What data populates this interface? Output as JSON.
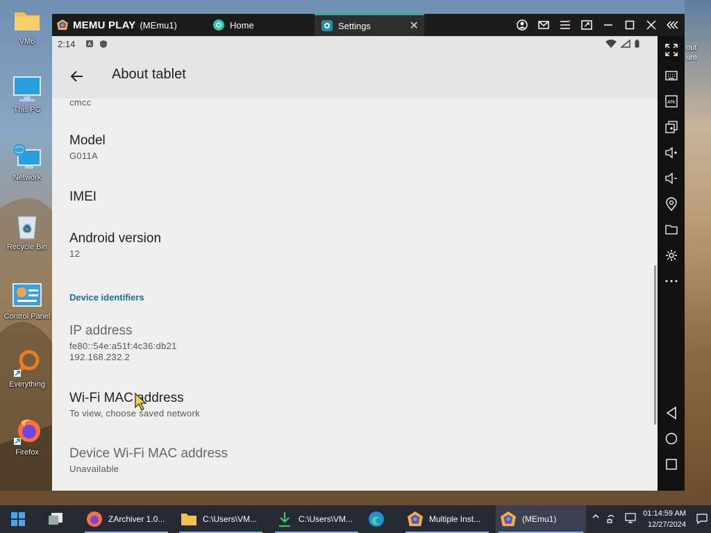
{
  "desktop": {
    "icons": [
      {
        "label": "VM6",
        "icon": "folder-icon"
      },
      {
        "label": "This PC",
        "icon": "monitor-icon"
      },
      {
        "label": "Network",
        "icon": "network-icon"
      },
      {
        "label": "Recycle Bin",
        "icon": "recycle-bin-icon"
      },
      {
        "label": "Control Panel",
        "icon": "control-panel-icon"
      },
      {
        "label": "Everything",
        "icon": "search-app-icon"
      },
      {
        "label": "Firefox",
        "icon": "firefox-icon"
      }
    ],
    "right_partial_labels": [
      "out",
      "ure"
    ]
  },
  "emulator": {
    "brand": "MEMU PLAY",
    "instance": "(MEmu1)",
    "tabs": [
      {
        "label": "Home",
        "icon": "home-app-icon"
      },
      {
        "label": "Settings",
        "icon": "settings-gear-icon",
        "close": "✕"
      }
    ]
  },
  "android": {
    "status": {
      "time": "2:14"
    },
    "appbar": {
      "title": "About tablet"
    },
    "items": [
      {
        "title": "",
        "summary": "cmcc"
      },
      {
        "title": "Model",
        "summary": "G011A"
      },
      {
        "title": "IMEI",
        "summary": ""
      },
      {
        "title": "Android version",
        "summary": "12"
      },
      {
        "title": "IP address",
        "summary": "fe80::54e:a51f:4c36:db21",
        "summary2": "192.168.232.2"
      },
      {
        "title": "Wi-Fi MAC address",
        "summary": "To view, choose saved network"
      },
      {
        "title": "Device Wi-Fi MAC address",
        "summary": "Unavailable"
      }
    ],
    "section_header": "Device identifiers"
  },
  "taskbar": {
    "items": [
      {
        "label": "ZArchiver 1.0..."
      },
      {
        "label": "C:\\Users\\VM..."
      },
      {
        "label": "C:\\Users\\VM..."
      },
      {
        "label": ""
      },
      {
        "label": "Multiple Inst..."
      },
      {
        "label": "(MEmu1)"
      }
    ],
    "clock": {
      "time": "01:14:59 AM",
      "date": "12/27/2024"
    }
  },
  "colors": {
    "accent": "#18b7a3",
    "section": "#1c6e8a",
    "taskbar": "#252a33"
  }
}
